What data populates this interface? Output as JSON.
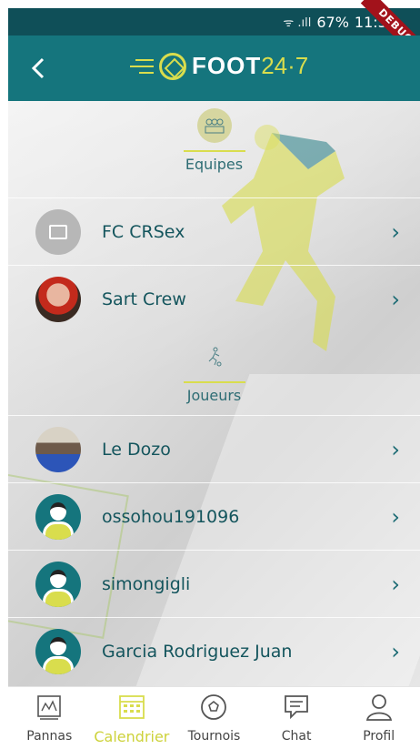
{
  "status_bar": {
    "signal": "ᯤ .ıll",
    "battery": "67%",
    "time": "11:35",
    "debug_label": "DEBUG"
  },
  "app_bar": {
    "back_icon": "chevron-left-icon",
    "logo_main": "FOOT",
    "logo_accent": "24·7"
  },
  "sections": {
    "teams": {
      "label": "Equipes",
      "icon": "team-icon"
    },
    "players": {
      "label": "Joueurs",
      "icon": "player-icon"
    }
  },
  "teams": [
    {
      "name": "FC CRSex",
      "avatar": "placeholder-image"
    },
    {
      "name": "Sart Crew",
      "avatar": "photo"
    }
  ],
  "players": [
    {
      "name": "Le Dozo",
      "avatar": "photo"
    },
    {
      "name": "ossohou191096",
      "avatar": "default-player"
    },
    {
      "name": "simongigli",
      "avatar": "default-player"
    },
    {
      "name": "Garcia Rodriguez Juan",
      "avatar": "default-player"
    }
  ],
  "chevron": "›",
  "tabs": [
    {
      "label": "Pannas",
      "icon": "pannas-icon",
      "active": false
    },
    {
      "label": "Calendrier",
      "icon": "calendar-icon",
      "active": true
    },
    {
      "label": "Tournois",
      "icon": "ball-icon",
      "active": false
    },
    {
      "label": "Chat",
      "icon": "chat-icon",
      "active": false
    },
    {
      "label": "Profil",
      "icon": "profile-icon",
      "active": false
    }
  ],
  "colors": {
    "primary": "#15757d",
    "accent": "#d9dd4d",
    "status_bar": "#0f4f58"
  }
}
